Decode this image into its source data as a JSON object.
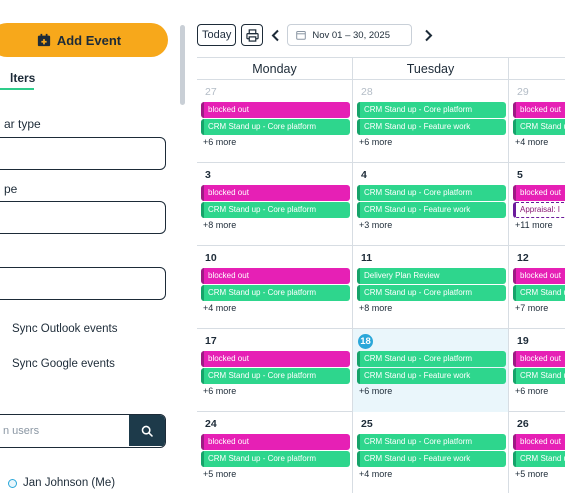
{
  "sidebar": {
    "add_event_label": "Add Event",
    "filters_tab": "lters",
    "calendar_type_label": "ar type",
    "type_label": "pe",
    "sync_outlook_label": "Sync Outlook events",
    "sync_google_label": "Sync Google events",
    "search_placeholder": "n users",
    "user_name": "Jan Johnson (Me)"
  },
  "toolbar": {
    "today_label": "Today",
    "date_range": "Nov 01 – 30, 2025"
  },
  "calendar": {
    "headers": [
      "Monday",
      "Tuesday",
      "W"
    ],
    "weeks": [
      {
        "days": [
          {
            "date": "27",
            "muted": true,
            "events": [
              {
                "title": "blocked out",
                "color": "pink"
              },
              {
                "title": "CRM Stand up - Core platform",
                "color": "green"
              }
            ],
            "more": "+6 more"
          },
          {
            "date": "28",
            "muted": true,
            "events": [
              {
                "title": "CRM Stand up - Core platform",
                "color": "green"
              },
              {
                "title": "CRM Stand up - Feature work",
                "color": "green"
              }
            ],
            "more": "+6 more"
          },
          {
            "date": "29",
            "muted": true,
            "events": [
              {
                "title": "blocked out",
                "color": "pink"
              },
              {
                "title": "CRM Stand up - Core platform",
                "color": "green"
              }
            ],
            "more": "+4 more"
          }
        ]
      },
      {
        "days": [
          {
            "date": "3",
            "events": [
              {
                "title": "blocked out",
                "color": "pink"
              },
              {
                "title": "CRM Stand up - Core platform",
                "color": "green"
              }
            ],
            "more": "+8 more"
          },
          {
            "date": "4",
            "events": [
              {
                "title": "CRM Stand up - Core platform",
                "color": "green"
              },
              {
                "title": "CRM Stand up - Feature work",
                "color": "green"
              }
            ],
            "more": "+3 more"
          },
          {
            "date": "5",
            "events": [
              {
                "title": "blocked out",
                "color": "pink"
              },
              {
                "title": "Appraisal: I",
                "color": "dashed"
              }
            ],
            "more": "+11 more"
          }
        ]
      },
      {
        "days": [
          {
            "date": "10",
            "events": [
              {
                "title": "blocked out",
                "color": "pink"
              },
              {
                "title": "CRM Stand up - Core platform",
                "color": "green"
              }
            ],
            "more": "+4 more"
          },
          {
            "date": "11",
            "events": [
              {
                "title": "Delivery Plan Review",
                "color": "green"
              },
              {
                "title": "CRM Stand up - Core platform",
                "color": "green"
              }
            ],
            "more": "+8 more"
          },
          {
            "date": "12",
            "events": [
              {
                "title": "blocked out",
                "color": "pink"
              },
              {
                "title": "CRM Stand up - Core platform",
                "color": "green"
              }
            ],
            "more": "+7 more"
          }
        ]
      },
      {
        "days": [
          {
            "date": "17",
            "events": [
              {
                "title": "blocked out",
                "color": "pink"
              },
              {
                "title": "CRM Stand up - Core platform",
                "color": "green"
              }
            ],
            "more": "+6 more"
          },
          {
            "date": "18",
            "today": true,
            "events": [
              {
                "title": "CRM Stand up - Core platform",
                "color": "green"
              },
              {
                "title": "CRM Stand up - Feature work",
                "color": "green"
              }
            ],
            "more": "+6 more"
          },
          {
            "date": "19",
            "events": [
              {
                "title": "blocked out",
                "color": "pink"
              },
              {
                "title": "CRM Stand up - Core platform",
                "color": "green"
              }
            ],
            "more": "+6 more"
          }
        ]
      },
      {
        "days": [
          {
            "date": "24",
            "events": [
              {
                "title": "blocked out",
                "color": "pink"
              },
              {
                "title": "CRM Stand up - Core platform",
                "color": "green"
              }
            ],
            "more": "+5 more"
          },
          {
            "date": "25",
            "events": [
              {
                "title": "CRM Stand up - Core platform",
                "color": "green"
              },
              {
                "title": "CRM Stand up - Feature work",
                "color": "green"
              }
            ],
            "more": "+4 more"
          },
          {
            "date": "26",
            "events": [
              {
                "title": "blocked out",
                "color": "pink"
              },
              {
                "title": "CRM Stand up - Core platform",
                "color": "green"
              }
            ],
            "more": "+5 more"
          }
        ]
      }
    ]
  },
  "colors": {
    "accent_orange": "#f7a81b",
    "event_pink": "#e620b5",
    "event_green": "#2ed68d",
    "today_blue": "#2ba7d9",
    "navy": "#1d2b38"
  },
  "icons": {
    "add_event": "calendar-plus-icon",
    "print": "printer-icon",
    "prev": "chevron-left-icon",
    "next": "chevron-right-icon",
    "date": "calendar-icon",
    "search": "search-icon"
  }
}
